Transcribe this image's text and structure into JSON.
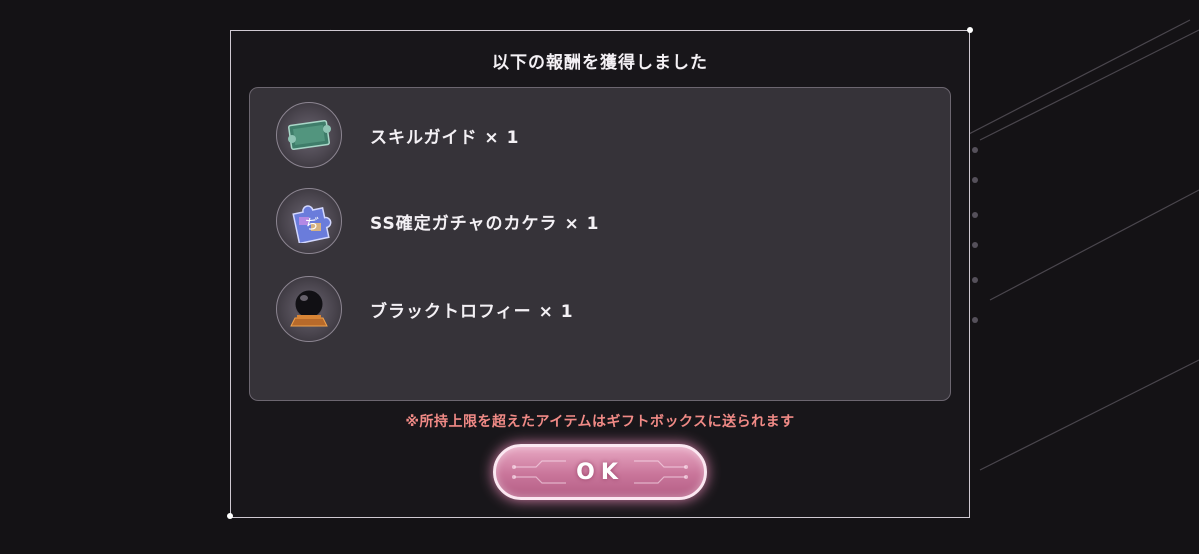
{
  "dialog": {
    "title": "以下の報酬を獲得しました",
    "notice": "※所持上限を超えたアイテムはギフトボックスに送られます",
    "ok_label": "OK"
  },
  "rewards": [
    {
      "name": "スキルガイド × 1",
      "icon": "skill-guide-scroll-icon"
    },
    {
      "name": "SS確定ガチャのカケラ × 1",
      "icon": "puzzle-fragment-icon"
    },
    {
      "name": "ブラックトロフィー × 1",
      "icon": "black-trophy-orb-icon"
    }
  ],
  "colors": {
    "background": "#141215",
    "panel": "#3a363c",
    "notice": "#f08a86",
    "button": "#c9759a",
    "button_border": "#fbe7f1"
  }
}
